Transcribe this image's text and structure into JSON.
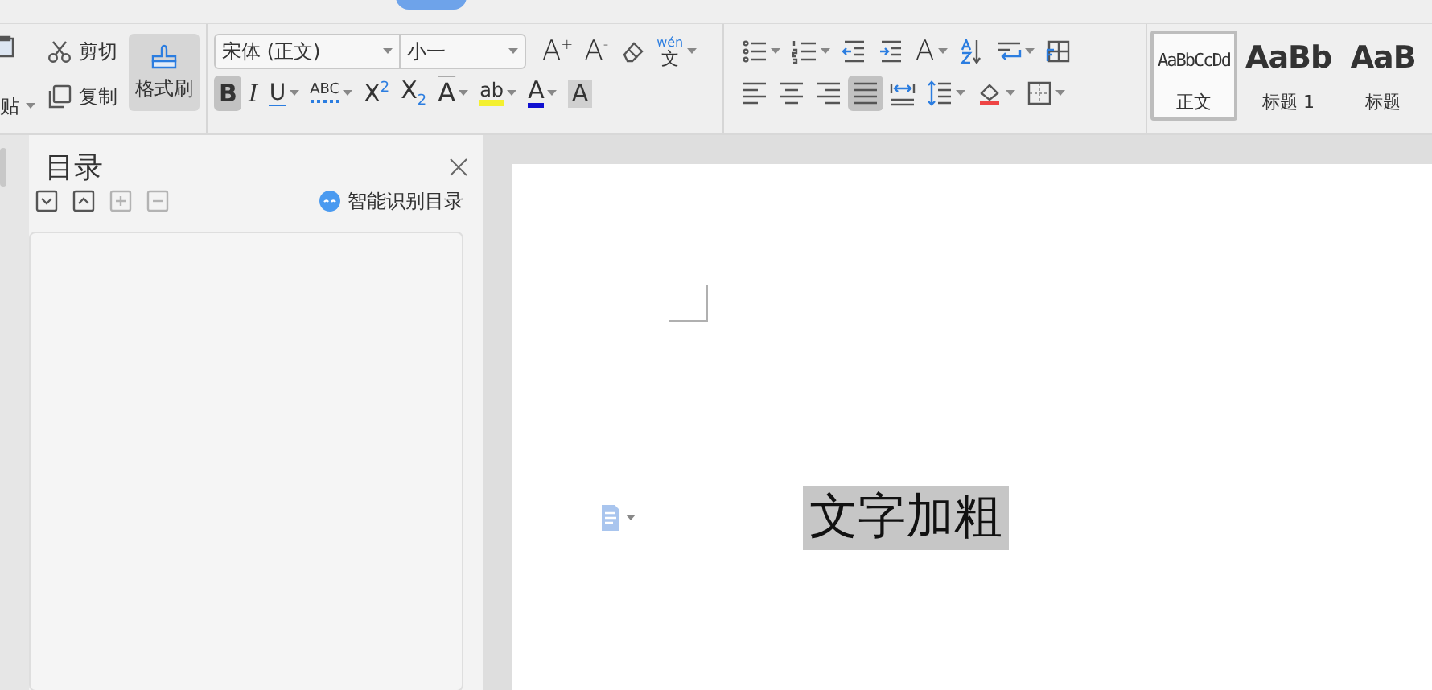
{
  "ribbon": {
    "clipboard": {
      "paste_label": "贴",
      "cut": "剪切",
      "copy": "复制",
      "format_painter": {
        "label": "格式刷",
        "selected": true
      }
    },
    "font": {
      "font_name": "宋体 (正文)",
      "font_size": "小一",
      "row_1": [
        {
          "kind": "grow-font",
          "glyph": "A$^{+}$",
          "dropdown": false,
          "selected": false
        },
        {
          "kind": "shrink-font",
          "glyph": "A$^{-}$",
          "dropdown": false,
          "selected": false
        },
        {
          "kind": "eraser",
          "dropdown": false,
          "selected": false
        },
        {
          "kind": "phonetic",
          "glyph": "文",
          "ruby": "wén",
          "dropdown": true,
          "selected": false
        }
      ],
      "row_2": [
        {
          "kind": "bold",
          "glyph": "B",
          "dropdown": false,
          "selected": true
        },
        {
          "kind": "italic",
          "glyph": "I",
          "dropdown": false,
          "selected": false
        },
        {
          "kind": "underline",
          "glyph": "U",
          "dropdown": true,
          "selected": false
        },
        {
          "kind": "emphasis",
          "glyph": "ABC",
          "dropdown": true,
          "selected": false
        },
        {
          "kind": "superscript",
          "glyph": "X$^{2}$",
          "dropdown": false,
          "selected": false
        },
        {
          "kind": "subscript",
          "glyph": "X$_{2}$",
          "dropdown": false,
          "selected": false
        },
        {
          "kind": "text-effect",
          "glyph": "A",
          "dropdown": true,
          "selected": false
        },
        {
          "kind": "highlight",
          "glyph": "ab",
          "dropdown": true,
          "selected": false
        },
        {
          "kind": "font-color",
          "glyph": "A",
          "dropdown": true,
          "selected": false
        },
        {
          "kind": "char-shading",
          "glyph": "A",
          "dropdown": false,
          "selected": false
        }
      ]
    },
    "paragraph": {
      "row_1": [
        {
          "kind": "bullets",
          "dropdown": true,
          "selected": false
        },
        {
          "kind": "numbering",
          "dropdown": true,
          "selected": false
        },
        {
          "kind": "outdent",
          "dropdown": false,
          "selected": false
        },
        {
          "kind": "indent",
          "dropdown": false,
          "selected": false
        },
        {
          "kind": "char-spacing",
          "glyph": "A",
          "dropdown": true,
          "selected": false
        },
        {
          "kind": "sort",
          "dropdown": false,
          "selected": false
        },
        {
          "kind": "line-break",
          "dropdown": true,
          "selected": false
        },
        {
          "kind": "text-box",
          "dropdown": false,
          "selected": false
        }
      ],
      "row_2": [
        {
          "kind": "align-left",
          "dropdown": false,
          "selected": false
        },
        {
          "kind": "align-center",
          "dropdown": false,
          "selected": false
        },
        {
          "kind": "align-right",
          "dropdown": false,
          "selected": false
        },
        {
          "kind": "justify",
          "dropdown": false,
          "selected": true
        },
        {
          "kind": "distribute",
          "dropdown": false,
          "selected": false
        },
        {
          "kind": "line-spacing",
          "dropdown": true,
          "selected": false
        },
        {
          "kind": "shading",
          "dropdown": true,
          "selected": false
        },
        {
          "kind": "borders",
          "dropdown": true,
          "selected": false
        }
      ]
    },
    "styles": [
      {
        "kind": "normal",
        "sample": "AaBbCcDd",
        "label": "正文",
        "selected": true
      },
      {
        "kind": "heading",
        "sample": "AaBb",
        "label": "标题 1",
        "selected": false
      },
      {
        "kind": "heading",
        "sample": "AaB",
        "label": "标题",
        "selected": false
      }
    ]
  },
  "toc_panel": {
    "title": "目录",
    "tools": [
      {
        "kind": "expand",
        "disabled": false
      },
      {
        "kind": "collapse",
        "disabled": false
      },
      {
        "kind": "add",
        "disabled": true
      },
      {
        "kind": "remove",
        "disabled": true
      }
    ],
    "smart_toc": "智能识别目录"
  },
  "document": {
    "text": "文字加粗",
    "selected": true
  }
}
